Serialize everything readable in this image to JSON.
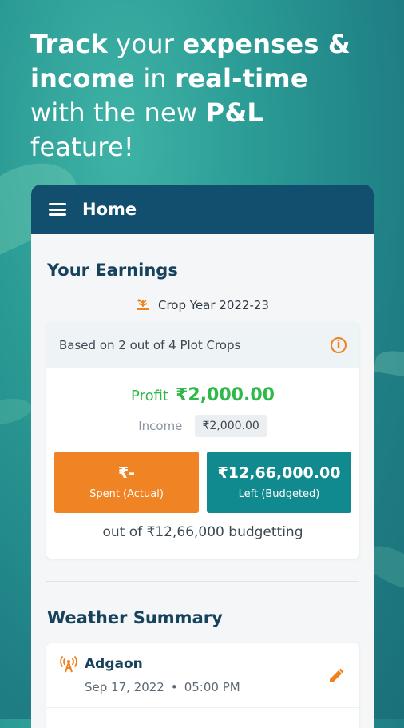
{
  "headline": {
    "p1": "Track",
    "p2": " your ",
    "p3": "expenses &",
    "p4": "income",
    "p5": " in ",
    "p6": "real-time",
    "p7": "with the new ",
    "p8": "P&L",
    "p9": "feature!"
  },
  "appbar": {
    "title": "Home"
  },
  "earnings": {
    "title": "Your Earnings",
    "crop_year": "Crop Year 2022-23",
    "based_on": "Based on 2 out of 4 Plot Crops",
    "profit_label": "Profit",
    "profit_value": "₹2,000.00",
    "income_label": "Income",
    "income_value": "₹2,000.00",
    "spent_value": "₹-",
    "spent_label": "Spent (Actual)",
    "left_value": "₹12,66,000.00",
    "left_label": "Left (Budgeted)",
    "budget_line": "out of ₹12,66,000 budgetting"
  },
  "weather": {
    "title": "Weather Summary",
    "location": "Adgaon",
    "date": "Sep 17, 2022",
    "separator": "•",
    "time": "05:00 PM"
  },
  "colors": {
    "appbar": "#124f6e",
    "profit": "#2fb94a",
    "spent": "#f08425",
    "left": "#108a8f",
    "accent_icon": "#f0821e"
  }
}
